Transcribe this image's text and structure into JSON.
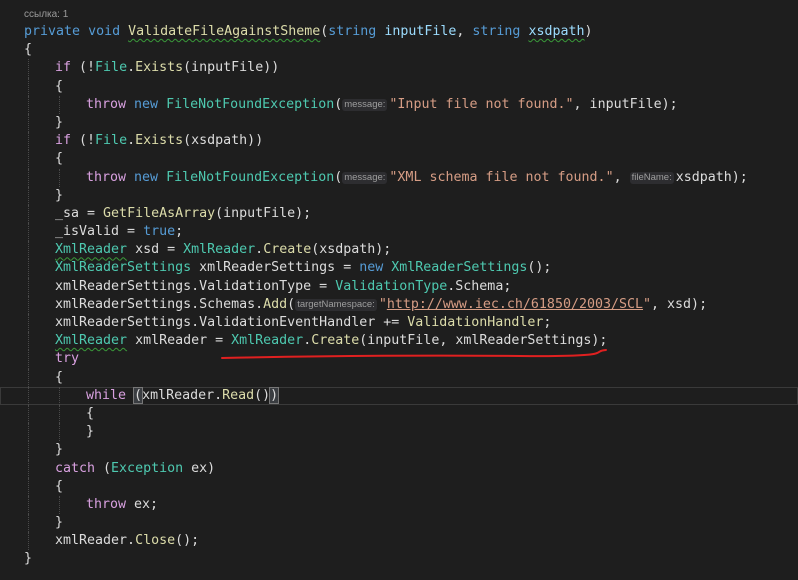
{
  "editor": {
    "codelens": "ссылка: 1",
    "l1": {
      "kw1": "private",
      "kw2": "void",
      "method": "ValidateFileAgainstSheme",
      "p1": "(",
      "t1": "string",
      "a1": "inputFile",
      "c1": ", ",
      "t2": "string",
      "a2": "xsdpath",
      "p2": ")"
    },
    "l2": "{",
    "l3": {
      "kw": "if",
      "a": " (!",
      "ty": "File",
      "dot": ".",
      "mt": "Exists",
      "b": "(inputFile))"
    },
    "l4": "{",
    "l5": {
      "kw1": "throw",
      "kw2": "new",
      "ty": "FileNotFoundException",
      "p": "(",
      "hint": "message:",
      "str": "\"Input file not found.\"",
      "rest": ", inputFile);"
    },
    "l6": "}",
    "l7": {
      "kw": "if",
      "a": " (!",
      "ty": "File",
      "dot": ".",
      "mt": "Exists",
      "b": "(xsdpath))"
    },
    "l8": "{",
    "l9": {
      "kw1": "throw",
      "kw2": "new",
      "ty": "FileNotFoundException",
      "p": "(",
      "hint": "message:",
      "str": "\"XML schema file not found.\"",
      "c": ", ",
      "hint2": "fileName:",
      "rest": "xsdpath);"
    },
    "l10": "}",
    "l11": {
      "a": "_sa = ",
      "mt": "GetFileAsArray",
      "b": "(inputFile);"
    },
    "l12": {
      "a": "_isValid = ",
      "kw": "true",
      "b": ";"
    },
    "l13": {
      "ty1": "XmlReader",
      "a": " xsd = ",
      "ty2": "XmlReader",
      "dot": ".",
      "mt": "Create",
      "b": "(xsdpath);"
    },
    "l14": {
      "ty1": "XmlReaderSettings",
      "a": " xmlReaderSettings = ",
      "kw": "new",
      "ty2": "XmlReaderSettings",
      "b": "();"
    },
    "l15": {
      "a": "xmlReaderSettings.ValidationType = ",
      "ty": "ValidationType",
      "b": ".Schema;"
    },
    "l16": {
      "a": "xmlReaderSettings.Schemas.",
      "mt": "Add",
      "p": "(",
      "hint": "targetNamespace:",
      "q1": "\"",
      "url": "http://www.iec.ch/61850/2003/SCL",
      "q2": "\"",
      "b": ", xsd);"
    },
    "l17": {
      "a": "xmlReaderSettings.ValidationEventHandler += ",
      "mt": "ValidationHandler",
      "b": ";"
    },
    "l18": {
      "ty1": "XmlReader",
      "a": " xmlReader = ",
      "ty2": "XmlReader",
      "dot": ".",
      "mt": "Create",
      "b": "(inputFile, xmlReaderSettings);"
    },
    "l19": "try",
    "l20": "{",
    "l21": {
      "kw": "while",
      "sp": " ",
      "open": "(",
      "mid": "xmlReader.",
      "mt": "Read",
      "b": "()",
      "close": ")"
    },
    "l22": "{",
    "l23": "}",
    "l24": "}",
    "l25": {
      "kw": "catch",
      "a": " (",
      "ty": "Exception",
      "b": " ex)"
    },
    "l26": "{",
    "l27": {
      "kw": "throw",
      "b": " ex;"
    },
    "l28": "}",
    "l29": {
      "a": "xmlReader.",
      "mt": "Close",
      "b": "();"
    },
    "l30": "}"
  },
  "colors": {
    "background": "#1e1e1e",
    "keyword": "#569cd6",
    "control_keyword": "#d8a0df",
    "type": "#4ec9b0",
    "method": "#dcdcaa",
    "string": "#d69d85",
    "annotation_underline": "#e02020"
  }
}
